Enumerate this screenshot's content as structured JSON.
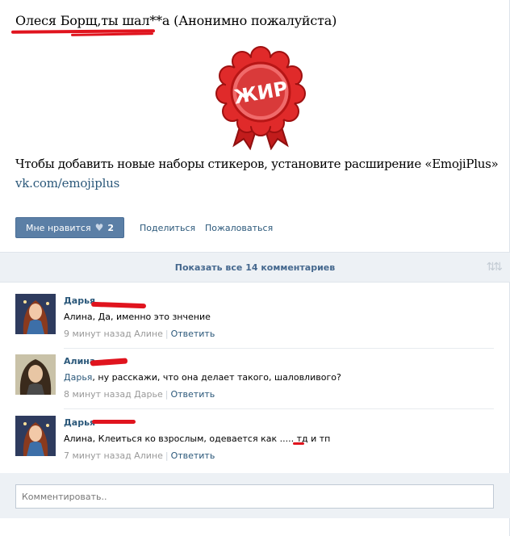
{
  "post": {
    "title": "Олеся Борщ,ты шал**а (Анонимно пожалуйста)",
    "sticker_text": "ЖИР",
    "extension_text": "Чтобы добавить новые наборы стикеров, установите расширение «EmojiPlus»",
    "extension_link": "vk.com/emojiplus"
  },
  "actions": {
    "like_label": "Мне нравится",
    "like_count": "2",
    "share_label": "Поделиться",
    "report_label": "Пожаловаться"
  },
  "comments_header": {
    "show_all_label": "Показать все 14 комментариев"
  },
  "comments": [
    {
      "author": "Дарья",
      "mention": "",
      "text": "Алина, Да, именно это знчение",
      "time": "9 минут назад Алине",
      "reply_label": "Ответить"
    },
    {
      "author": "Алина",
      "mention": "Дарья",
      "text": ", ну расскажи, что она делает такого, шаловливого?",
      "time": "8 минут назад Дарье",
      "reply_label": "Ответить"
    },
    {
      "author": "Дарья",
      "mention": "",
      "text": "Алина, Клеиться ко взрослым, одевается как ..... тд и тп",
      "time": "7 минут назад Алине",
      "reply_label": "Ответить"
    }
  ],
  "comment_box": {
    "placeholder": "Комментировать.."
  },
  "colors": {
    "accent": "#5b7fa6",
    "link": "#2b587a",
    "redline": "#e0141e"
  },
  "icons": [
    "heart-icon",
    "sort-icon",
    "ribbon-sticker"
  ]
}
